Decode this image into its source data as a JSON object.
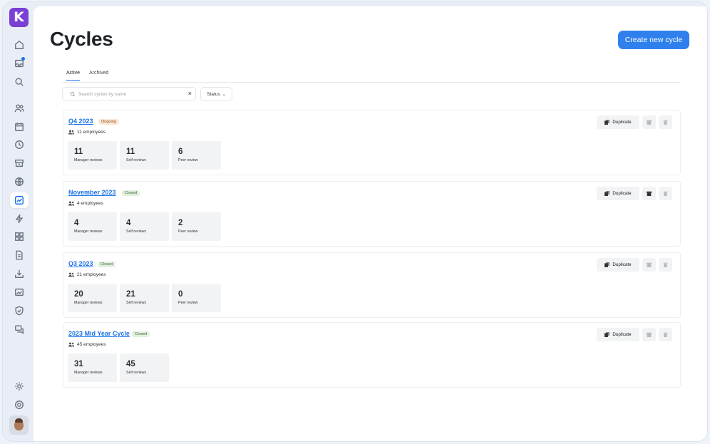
{
  "app": {
    "logo_letter": "K"
  },
  "page": {
    "title": "Cycles",
    "create_button": "Create new cycle"
  },
  "tabs": [
    {
      "label": "Active"
    },
    {
      "label": "Archived"
    }
  ],
  "search": {
    "placeholder": "Search cycles by name",
    "clear_label": "×"
  },
  "filters": {
    "status_label": "Status"
  },
  "actions": {
    "duplicate_label": "Duplicate"
  },
  "cycles": [
    {
      "title": "Q4 2023",
      "status": "Ongoing",
      "employees": "11 employees",
      "stats": [
        {
          "value": "11",
          "label": "Manager reviews"
        },
        {
          "value": "11",
          "label": "Self reviews"
        },
        {
          "value": "6",
          "label": "Peer review"
        }
      ]
    },
    {
      "title": "November 2023",
      "status": "Closed",
      "employees": "4 employees",
      "stats": [
        {
          "value": "4",
          "label": "Manager reviews"
        },
        {
          "value": "4",
          "label": "Self reviews"
        },
        {
          "value": "2",
          "label": "Peer review"
        }
      ]
    },
    {
      "title": "Q3 2023",
      "status": "Closed",
      "employees": "21 employees",
      "stats": [
        {
          "value": "20",
          "label": "Manager reviews"
        },
        {
          "value": "21",
          "label": "Self reviews"
        },
        {
          "value": "0",
          "label": "Peer review"
        }
      ]
    },
    {
      "title": "2023 Mid Year Cycle",
      "status": "Closed",
      "employees": "45 employees",
      "stats": [
        {
          "value": "31",
          "label": "Manager reviews"
        },
        {
          "value": "45",
          "label": "Self reviews"
        }
      ]
    }
  ],
  "colors": {
    "accent": "#2f80ed",
    "brand": "#7b3fd6",
    "ongoing_badge": "#fbe8d6",
    "closed_badge": "#e1f0df"
  }
}
